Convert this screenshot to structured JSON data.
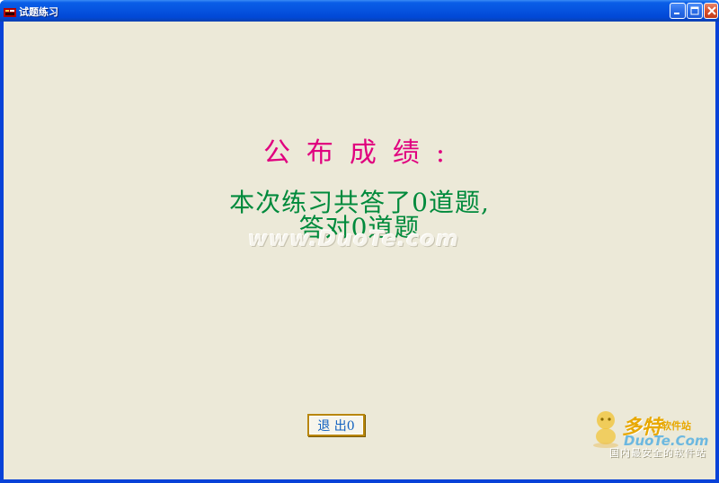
{
  "window": {
    "title": "试题练习"
  },
  "content": {
    "result_title": "公布成绩:",
    "summary_line1": "本次练习共答了0道题,",
    "summary_line2": "答对0道题"
  },
  "buttons": {
    "exit_label": "退 出0"
  },
  "watermark": {
    "center_text": "www.DuoTe.com",
    "logo_name": "多特",
    "logo_site": "软件站",
    "logo_domain": "DuoTe.Com",
    "logo_slogan": "国内最安全的软件站"
  },
  "colors": {
    "title_magenta": "#e0007f",
    "summary_green": "#008a3c",
    "client_bg": "#ece9d8",
    "exit_text": "#1060c0"
  }
}
